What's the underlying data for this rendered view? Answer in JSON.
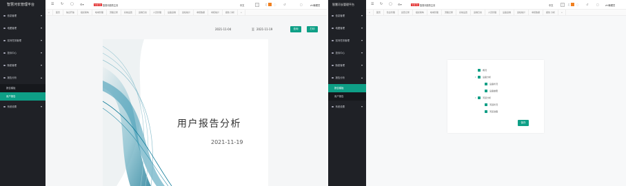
{
  "left": {
    "sidebar": {
      "brand": "智慧河长管理平台",
      "items": [
        {
          "label": "信息管理"
        },
        {
          "label": "地图管理"
        },
        {
          "label": "巡河任务管理"
        },
        {
          "label": "投诉中心"
        },
        {
          "label": "隐患管理"
        },
        {
          "label": "报告分析",
          "expanded": true
        }
      ],
      "submenu": [
        {
          "label": "报告模板"
        },
        {
          "label": "用户报告",
          "active": true
        }
      ],
      "after": [
        {
          "label": "系统设置"
        }
      ]
    },
    "topbar": {
      "brand_tag": "智慧河长",
      "link": "智慧河道的主页",
      "lang": "中文",
      "user": "zhi管理员"
    },
    "tabs": [
      "首页",
      "信息开放",
      "组织架构",
      "地域管理",
      "流程记录",
      "系统设置",
      "运维日志",
      "人员管理",
      "设备运维",
      "巡检统计",
      "考核数据",
      "考核统计",
      "报告 分析"
    ],
    "toolbar": {
      "date_start": "2021-11-04",
      "date_sep": "至",
      "date_end": "2021-11-19",
      "query_label": "查询",
      "print_label": "打印"
    },
    "report": {
      "title": "用户报告分析",
      "date": "2021-11-19"
    }
  },
  "right": {
    "sidebar": {
      "brand": "智慧河长管理平台",
      "items": [
        {
          "label": "信息管理"
        },
        {
          "label": "地图管理"
        },
        {
          "label": "巡河任务管理"
        },
        {
          "label": "投诉中心"
        },
        {
          "label": "隐患管理"
        },
        {
          "label": "报告分析",
          "expanded": true
        }
      ],
      "submenu": [
        {
          "label": "报告模板",
          "active": true
        },
        {
          "label": "用户报告"
        }
      ],
      "after": [
        {
          "label": "系统设置"
        }
      ]
    },
    "topbar": {
      "brand_tag": "智慧河长",
      "link": "智慧河道的主页",
      "lang": "中文",
      "user": "zhi管理员"
    },
    "tabs": [
      "首页",
      "隐患管理",
      "巡查记录",
      "组织架构",
      "地域管理",
      "流程记录",
      "系统设置",
      "运维日志",
      "人员管理",
      "设备运维",
      "巡检统计",
      "考核数据",
      "报告 分析"
    ],
    "tree": [
      {
        "label": "概况",
        "level": 1,
        "checked": true
      },
      {
        "label": "设备分析",
        "level": 1,
        "checked": true
      },
      {
        "label": "设备状况",
        "level": 2,
        "checked": true
      },
      {
        "label": "设备故障",
        "level": 2,
        "checked": true
      },
      {
        "label": "河道分析",
        "level": 1,
        "checked": true
      },
      {
        "label": "河道状况",
        "level": 2,
        "checked": true
      },
      {
        "label": "河道治理",
        "level": 2,
        "checked": true
      }
    ],
    "save_label": "保存"
  },
  "colors": {
    "accent": "#0e9f86",
    "sidebar": "#1f2126",
    "brand_tag": "#e02020"
  }
}
